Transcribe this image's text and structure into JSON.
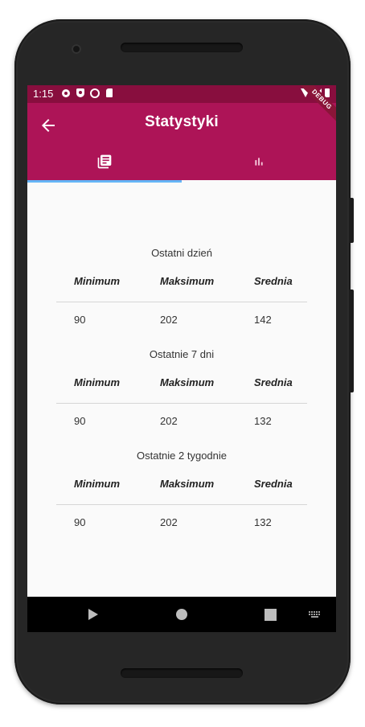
{
  "status_bar": {
    "time": "1:15",
    "icons": [
      "gear-icon",
      "shield-icon",
      "circle-icon",
      "sd-card-icon"
    ],
    "right_icons": [
      "wifi-icon",
      "signal-icon",
      "battery-icon"
    ],
    "debug_label": "DEBUG"
  },
  "app_bar": {
    "title": "Statystyki",
    "back_icon": "arrow-left-icon",
    "color": "#ad1457",
    "status_color": "#880e3e"
  },
  "tabs": [
    {
      "icon": "library-books-icon",
      "selected": true
    },
    {
      "icon": "bar-chart-icon",
      "selected": false
    }
  ],
  "tab_indicator_color": "#64b5f6",
  "sections": [
    {
      "title": "Ostatni dzień",
      "headers": [
        "Minimum",
        "Maksimum",
        "Srednia"
      ],
      "values": [
        "90",
        "202",
        "142"
      ]
    },
    {
      "title": "Ostatnie 7 dni",
      "headers": [
        "Minimum",
        "Maksimum",
        "Srednia"
      ],
      "values": [
        "90",
        "202",
        "132"
      ]
    },
    {
      "title": "Ostatnie 2 tygodnie",
      "headers": [
        "Minimum",
        "Maksimum",
        "Srednia"
      ],
      "values": [
        "90",
        "202",
        "132"
      ]
    }
  ],
  "nav_bar": {
    "buttons": [
      "back-triangle-icon",
      "home-circle-icon",
      "recents-square-icon",
      "keyboard-icon"
    ]
  }
}
